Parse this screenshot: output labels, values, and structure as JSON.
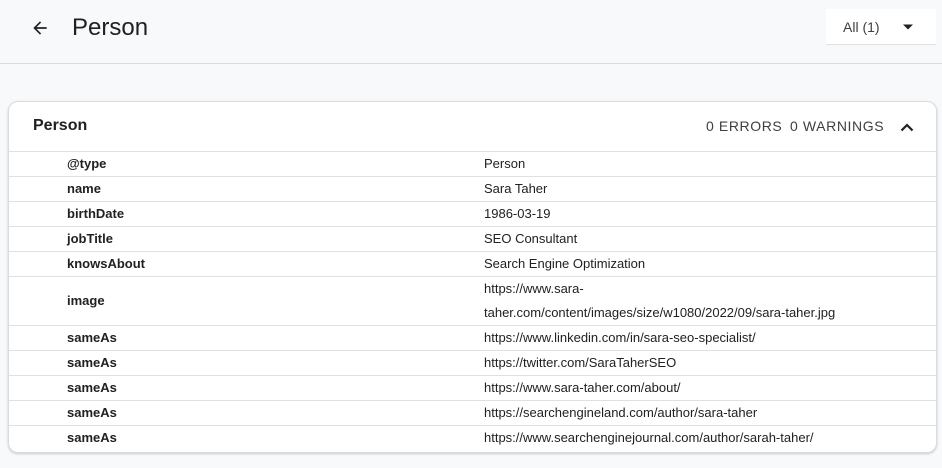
{
  "header": {
    "title": "Person",
    "filter_value": "All (1)"
  },
  "card": {
    "title": "Person",
    "errors": "0 ERRORS",
    "warnings": "0 WARNINGS"
  },
  "rows": [
    {
      "key": "@type",
      "value": "Person"
    },
    {
      "key": "name",
      "value": "Sara Taher"
    },
    {
      "key": "birthDate",
      "value": "1986-03-19"
    },
    {
      "key": "jobTitle",
      "value": "SEO Consultant"
    },
    {
      "key": "knowsAbout",
      "value": "Search Engine Optimization"
    },
    {
      "key": "image",
      "value_line1": "https://www.sara-",
      "value_line2": "taher.com/content/images/size/w1080/2022/09/sara-taher.jpg"
    },
    {
      "key": "sameAs",
      "value": "https://www.linkedin.com/in/sara-seo-specialist/"
    },
    {
      "key": "sameAs",
      "value": "https://twitter.com/SaraTaherSEO"
    },
    {
      "key": "sameAs",
      "value": "https://www.sara-taher.com/about/"
    },
    {
      "key": "sameAs",
      "value": "https://searchengineland.com/author/sara-taher"
    },
    {
      "key": "sameAs",
      "value": "https://www.searchenginejournal.com/author/sarah-taher/"
    }
  ],
  "icons": {
    "back": "arrow-back-icon",
    "dropdown": "caret-down-icon",
    "collapse": "chevron-up-icon"
  }
}
